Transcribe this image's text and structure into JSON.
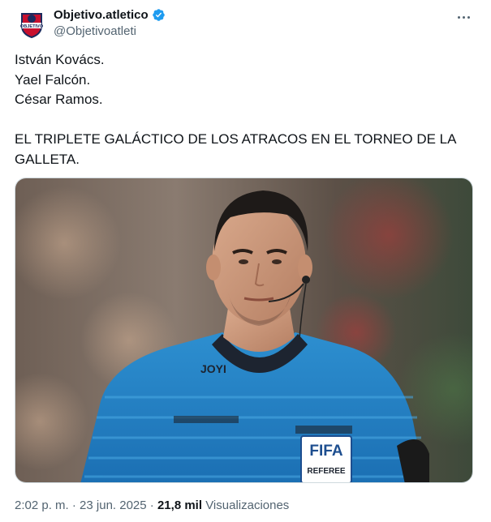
{
  "author": {
    "display_name": "Objetivo.atletico",
    "handle": "@Objetivoatleti",
    "avatar_text": "OBJETIVO",
    "verified": true,
    "verified_color": "#1d9bf0"
  },
  "tweet": {
    "lines": [
      "István Kovács.",
      "Yael Falcón.",
      "César Ramos.",
      "",
      "EL TRIPLETE GALÁCTICO DE LOS ATRACOS EN EL TORNEO DE LA GALLETA."
    ],
    "media": {
      "badge_brand": "FIFA",
      "badge_role": "REFEREE",
      "kit_logo": "JOYI"
    }
  },
  "meta": {
    "time": "2:02 p. m.",
    "separator": "·",
    "date": "23 jun. 2025",
    "views_count": "21,8 mil",
    "views_label": "Visualizaciones"
  },
  "icons": {
    "more": "more-icon",
    "verified": "verified-badge-icon"
  }
}
